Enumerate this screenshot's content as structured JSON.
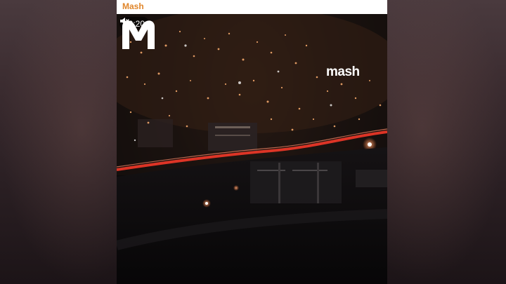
{
  "post": {
    "channel_name": "Mash"
  },
  "video": {
    "elapsed_time": "00:20",
    "volume_icon": "speaker-muted-icon",
    "watermark_text": "mash",
    "watermark_icon": "mash-logo-icon"
  },
  "colors": {
    "channel_accent": "#e0862b",
    "video_background": "#0b0a0c",
    "city_lights": "#ff7a3c"
  }
}
